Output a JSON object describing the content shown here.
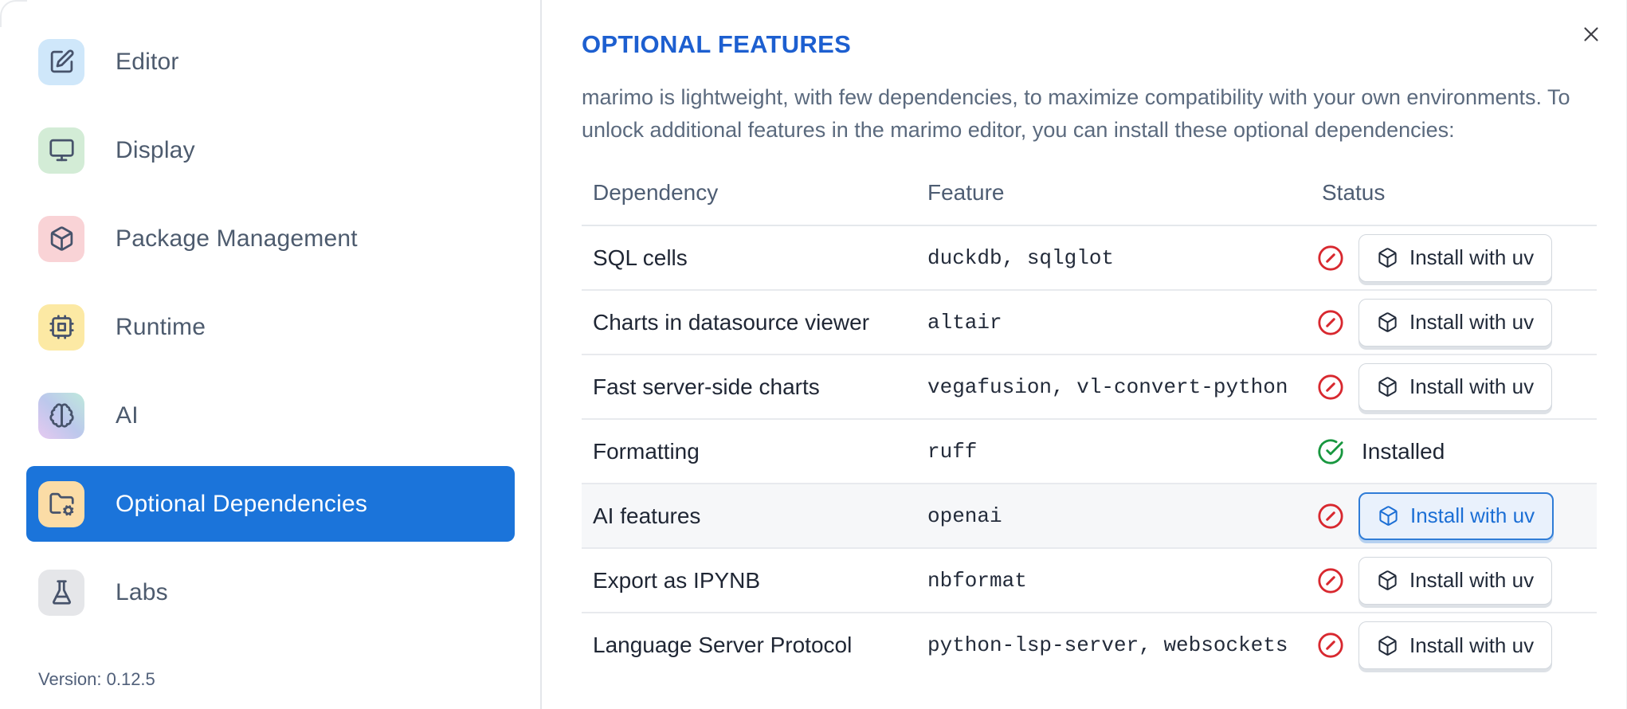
{
  "sidebar": {
    "items": [
      {
        "label": "Editor",
        "icon": "square-pen",
        "icon_bg": "#cfe7fa",
        "selected": false
      },
      {
        "label": "Display",
        "icon": "monitor",
        "icon_bg": "#d3ecd6",
        "selected": false
      },
      {
        "label": "Package Management",
        "icon": "box",
        "icon_bg": "#f9d3d6",
        "selected": false
      },
      {
        "label": "Runtime",
        "icon": "cpu",
        "icon_bg": "#fce9a4",
        "selected": false
      },
      {
        "label": "AI",
        "icon": "brain",
        "icon_bg": "linear-gradient(45deg,#e6c9f0 0%,#bcc8ec 50%,#bfe9dc 100%)",
        "selected": false
      },
      {
        "label": "Optional Dependencies",
        "icon": "folder-cog",
        "icon_bg": "#fbdca6",
        "selected": true
      },
      {
        "label": "Labs",
        "icon": "flask-conical",
        "icon_bg": "#e5e6e9",
        "selected": false
      }
    ],
    "selected_bg": "#1b74da",
    "version_label": "Version: 0.12.5"
  },
  "panel": {
    "title": "OPTIONAL FEATURES",
    "title_color": "#1d5fd0",
    "description": "marimo is lightweight, with few dependencies, to maximize compatibility with your own environments. To unlock additional features in the marimo editor, you can install these optional dependencies:"
  },
  "table": {
    "columns": [
      "Dependency",
      "Feature",
      "Status"
    ],
    "status_colors": {
      "missing": "#d8282f",
      "installed": "#18973f"
    },
    "rows": [
      {
        "dependency": "SQL cells",
        "feature": "duckdb, sqlglot",
        "installed": false,
        "action": "Install with uv"
      },
      {
        "dependency": "Charts in datasource viewer",
        "feature": "altair",
        "installed": false,
        "action": "Install with uv"
      },
      {
        "dependency": "Fast server-side charts",
        "feature": "vegafusion, vl-convert-python",
        "installed": false,
        "action": "Install with uv"
      },
      {
        "dependency": "Formatting",
        "feature": "ruff",
        "installed": true,
        "status_label": "Installed"
      },
      {
        "dependency": "AI features",
        "feature": "openai",
        "installed": false,
        "action": "Install with uv",
        "highlighted": true,
        "focused": true
      },
      {
        "dependency": "Export as IPYNB",
        "feature": "nbformat",
        "installed": false,
        "action": "Install with uv"
      },
      {
        "dependency": "Language Server Protocol",
        "feature": "python-lsp-server, websockets",
        "installed": false,
        "action": "Install with uv"
      }
    ]
  }
}
